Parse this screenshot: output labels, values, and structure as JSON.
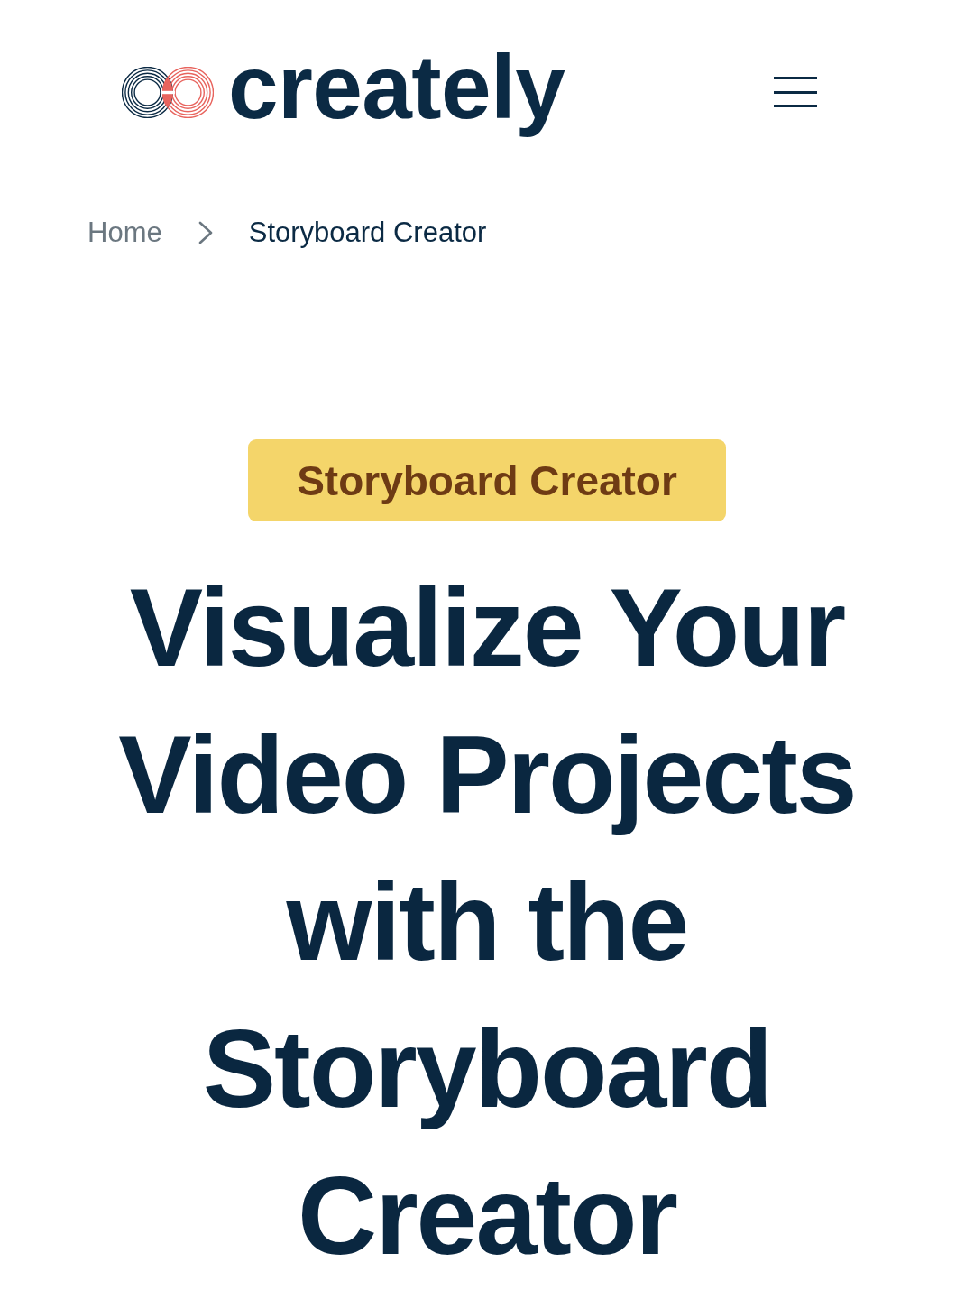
{
  "header": {
    "logo_text": "creately"
  },
  "breadcrumb": [
    {
      "label": "Home",
      "current": false
    },
    {
      "label": "Storyboard Creator",
      "current": true
    }
  ],
  "hero": {
    "badge": "Storyboard Creator",
    "heading": "Visualize Your Video Projects with the Storyboard Creator"
  }
}
